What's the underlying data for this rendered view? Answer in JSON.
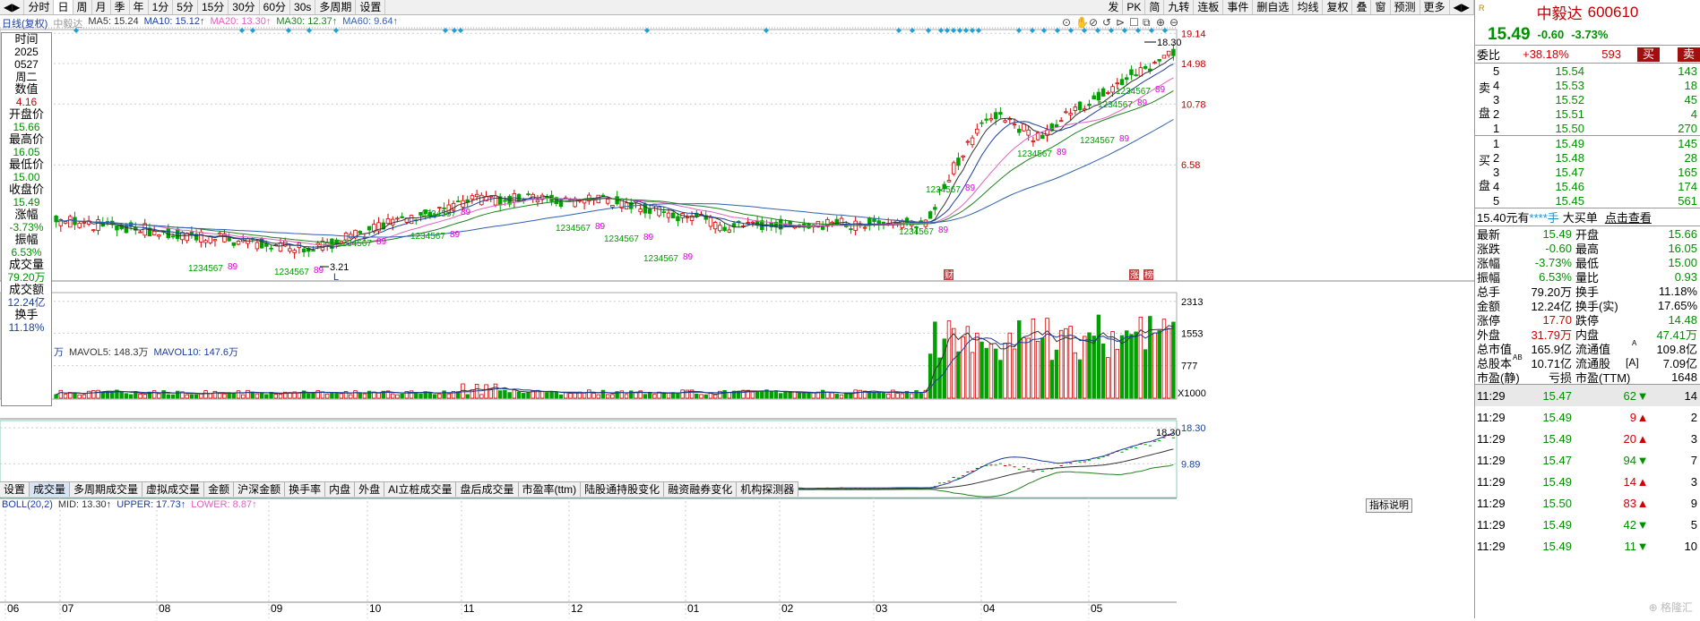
{
  "toolbar": {
    "left": [
      "◀▶",
      "分时",
      "日",
      "周",
      "月",
      "季",
      "年",
      "1分",
      "5分",
      "15分",
      "30分",
      "60分",
      "30s",
      "多周期",
      "设置"
    ],
    "active": "日",
    "right": [
      "发",
      "PK",
      "简",
      "九转",
      "连板",
      "事件",
      "删自选",
      "均线",
      "复权",
      "叠",
      "窗",
      "预测",
      "更多",
      "◀▶"
    ]
  },
  "main_info": {
    "period": "日线(复权)",
    "name": "中毅达",
    "ma5": "MA5: 15.24",
    "ma10": "MA10: 15.12↑",
    "ma20": "MA20: 13.30↑",
    "ma30": "MA30: 12.37↑",
    "ma60": "MA60: 9.64↑"
  },
  "colors": {
    "up": "#d00000",
    "down": "#00a000",
    "ma5": "#333333",
    "ma10": "#1a3e9c",
    "ma20": "#e060c0",
    "ma30": "#208020",
    "ma60": "#3060b0",
    "grid": "#c0c0c0",
    "marker": "#20a0d0"
  },
  "data_panel": [
    {
      "label": "时间",
      "value": "2025",
      "vclass": ""
    },
    {
      "label": "",
      "value": "0527",
      "vclass": ""
    },
    {
      "label": "",
      "value": "周二",
      "vclass": ""
    },
    {
      "label": "数值",
      "value": "4.16",
      "vclass": "red"
    },
    {
      "label": "开盘价",
      "value": "15.66",
      "vclass": "green"
    },
    {
      "label": "最高价",
      "value": "16.05",
      "vclass": "green"
    },
    {
      "label": "最低价",
      "value": "15.00",
      "vclass": "green"
    },
    {
      "label": "收盘价",
      "value": "15.49",
      "vclass": "green"
    },
    {
      "label": "涨幅",
      "value": "-3.73%",
      "vclass": "green"
    },
    {
      "label": "振幅",
      "value": "6.53%",
      "vclass": "green"
    },
    {
      "label": "成交量",
      "value": "79.20万",
      "vclass": "green"
    },
    {
      "label": "成交额",
      "value": "12.24亿",
      "vclass": "blue"
    },
    {
      "label": "换手",
      "value": "11.18%",
      "vclass": "blue"
    }
  ],
  "price_axis": [
    "19.14",
    "14.98",
    "10.78",
    "6.58"
  ],
  "high_label": "18.30",
  "low_label": "3.21",
  "low_marker": "L",
  "vol_info": {
    "left": "万",
    "mavol5": "MAVOL5: 148.3万",
    "mavol10": "MAVOL10: 147.6万"
  },
  "vol_axis": [
    "2313",
    "1553",
    "777",
    "X1000"
  ],
  "tabs": [
    "设置",
    "成交量",
    "多周期成交量",
    "虚拟成交量",
    "金额",
    "沪深金额",
    "换手率",
    "内盘",
    "外盘",
    "AI立桩成交量",
    "盘后成交量",
    "市盈率(ttm)",
    "陆股通持股变化",
    "融资融券变化",
    "机构探测器"
  ],
  "tab_active": "成交量",
  "boll_info": {
    "name": "BOLL(20,2)",
    "mid": "MID: 13.30↑",
    "upper": "UPPER: 17.73↑",
    "lower": "LOWER: 8.87↑"
  },
  "boll_axis": [
    "18.30",
    "9.89"
  ],
  "boll_high": "18.30",
  "boll_low": "3.21",
  "indicator_help": "指标说明",
  "x_axis": [
    "06",
    "07",
    "08",
    "09",
    "10",
    "11",
    "12",
    "01",
    "02",
    "03",
    "04",
    "05"
  ],
  "event_labels": [
    "财",
    "涨",
    "榜"
  ],
  "td_sequences": [
    {
      "text": "1234567",
      "color": "#00a000"
    },
    {
      "text": "89",
      "color": "#e000e0"
    }
  ],
  "stock": {
    "name": "中毅达",
    "code": "600610",
    "price": "15.49",
    "change": "-0.60",
    "pct": "-3.73%"
  },
  "weibi": {
    "label": "委比",
    "ratio": "+38.18%",
    "diff": "593",
    "buy_btn": "买",
    "sell_btn": "卖"
  },
  "sell_label": [
    "卖",
    "盘"
  ],
  "buy_label": [
    "买",
    "盘"
  ],
  "asks": [
    {
      "n": "5",
      "price": "15.54",
      "vol": "143"
    },
    {
      "n": "4",
      "price": "15.53",
      "vol": "18"
    },
    {
      "n": "3",
      "price": "15.52",
      "vol": "45"
    },
    {
      "n": "2",
      "price": "15.51",
      "vol": "4"
    },
    {
      "n": "1",
      "price": "15.50",
      "vol": "270"
    }
  ],
  "bids": [
    {
      "n": "1",
      "price": "15.49",
      "vol": "145"
    },
    {
      "n": "2",
      "price": "15.48",
      "vol": "28"
    },
    {
      "n": "3",
      "price": "15.47",
      "vol": "165"
    },
    {
      "n": "4",
      "price": "15.46",
      "vol": "174"
    },
    {
      "n": "5",
      "price": "15.45",
      "vol": "561"
    }
  ],
  "bigorder": {
    "left": "15.40元有",
    "stars": "****手",
    "mid": "大买单",
    "link": "点击查看"
  },
  "quote": [
    {
      "l1": "最新",
      "v1": "15.49",
      "c1": "green",
      "l2": "开盘",
      "v2": "15.66",
      "c2": "green"
    },
    {
      "l1": "涨跌",
      "v1": "-0.60",
      "c1": "green",
      "l2": "最高",
      "v2": "16.05",
      "c2": "green"
    },
    {
      "l1": "涨幅",
      "v1": "-3.73%",
      "c1": "green",
      "l2": "最低",
      "v2": "15.00",
      "c2": "green"
    },
    {
      "l1": "振幅",
      "v1": "6.53%",
      "c1": "green",
      "l2": "量比",
      "v2": "0.93",
      "c2": "green"
    },
    {
      "l1": "总手",
      "v1": "79.20万",
      "c1": "",
      "l2": "换手",
      "v2": "11.18%",
      "c2": ""
    },
    {
      "l1": "金额",
      "v1": "12.24亿",
      "c1": "",
      "l2": "换手(实)",
      "v2": "17.65%",
      "c2": ""
    },
    {
      "l1": "涨停",
      "v1": "17.70",
      "c1": "red",
      "l2": "跌停",
      "v2": "14.48",
      "c2": "green"
    },
    {
      "l1": "外盘",
      "v1": "31.79万",
      "c1": "red",
      "l2": "内盘",
      "v2": "47.41万",
      "c2": "green"
    },
    {
      "l1": "总市值",
      "v1": "165.9亿",
      "c1": "",
      "l2": "流通值",
      "v2": "109.8亿",
      "c2": ""
    },
    {
      "l1": "总股本",
      "v1": "10.71亿",
      "c1": "",
      "l2": "流通股",
      "v2": "7.09亿",
      "c2": ""
    },
    {
      "l1": "市盈(静)",
      "v1": "亏损",
      "c1": "",
      "l2": "市盈(TTM)",
      "v2": "1648",
      "c2": ""
    }
  ],
  "quote_tags": {
    "ab": "AB",
    "a": "A",
    "a2": "[A]"
  },
  "ticks": [
    {
      "time": "11:29",
      "price": "15.47",
      "pc": "green",
      "vol": "62",
      "dir": "down",
      "n": "14"
    },
    {
      "time": "11:29",
      "price": "15.49",
      "pc": "green",
      "vol": "9",
      "dir": "up",
      "n": "2"
    },
    {
      "time": "11:29",
      "price": "15.49",
      "pc": "green",
      "vol": "20",
      "dir": "up",
      "n": "3"
    },
    {
      "time": "11:29",
      "price": "15.47",
      "pc": "green",
      "vol": "94",
      "dir": "down",
      "n": "7"
    },
    {
      "time": "11:29",
      "price": "15.49",
      "pc": "green",
      "vol": "14",
      "dir": "up",
      "n": "3"
    },
    {
      "time": "11:29",
      "price": "15.50",
      "pc": "green",
      "vol": "83",
      "dir": "up",
      "n": "9"
    },
    {
      "time": "11:29",
      "price": "15.49",
      "pc": "green",
      "vol": "42",
      "dir": "down",
      "n": "5"
    },
    {
      "time": "11:29",
      "price": "15.49",
      "pc": "green",
      "vol": "11",
      "dir": "down",
      "n": "10"
    }
  ],
  "watermark": "格隆汇"
}
